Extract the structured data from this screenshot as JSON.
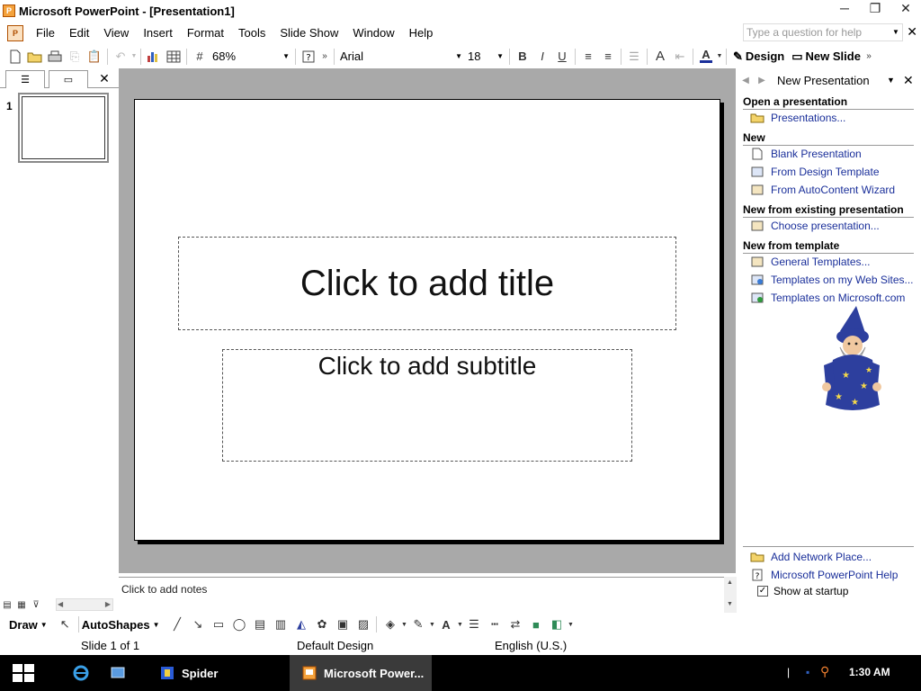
{
  "window": {
    "title": "Microsoft PowerPoint - [Presentation1]",
    "minimize_glyph": "─",
    "restore_glyph": "❐",
    "close_glyph": "✕"
  },
  "menu": {
    "items": [
      "File",
      "Edit",
      "View",
      "Insert",
      "Format",
      "Tools",
      "Slide Show",
      "Window",
      "Help"
    ],
    "help_placeholder": "Type a question for help"
  },
  "toolbar": {
    "zoom": "68%",
    "font": "Arial",
    "font_size": "18",
    "bold": "B",
    "italic": "I",
    "underline": "U",
    "design_label": "Design",
    "new_slide_label": "New Slide"
  },
  "outline": {
    "slide_number": "1"
  },
  "slide": {
    "title_placeholder": "Click to add title",
    "subtitle_placeholder": "Click to add subtitle"
  },
  "notes": {
    "placeholder": "Click to add notes"
  },
  "taskpane": {
    "title": "New Presentation",
    "sections": {
      "open": "Open a presentation",
      "new": "New",
      "existing": "New from existing presentation",
      "template": "New from template"
    },
    "links": {
      "presentations": "Presentations...",
      "blank": "Blank Presentation",
      "design_template": "From Design Template",
      "autocontent": "From AutoContent Wizard",
      "choose": "Choose presentation...",
      "general_templates": "General Templates...",
      "web_sites": "Templates on my Web Sites...",
      "microsoft_com": "Templates on Microsoft.com",
      "network_place": "Add Network Place...",
      "pp_help": "Microsoft PowerPoint Help"
    },
    "show_at_startup": "Show at startup",
    "show_at_startup_checked": true
  },
  "drawing": {
    "draw_label": "Draw",
    "autoshapes_label": "AutoShapes"
  },
  "status": {
    "slide": "Slide 1 of 1",
    "design": "Default Design",
    "language": "English (U.S.)"
  },
  "taskbar": {
    "tasks": [
      "Spider",
      "Microsoft Power..."
    ],
    "clock": "1:30 AM"
  },
  "colors": {
    "link": "#1a2f9a",
    "canvas_bg": "#a9a9a9",
    "taskbar_bg": "#000000",
    "brand_orange": "#f4a23c"
  }
}
